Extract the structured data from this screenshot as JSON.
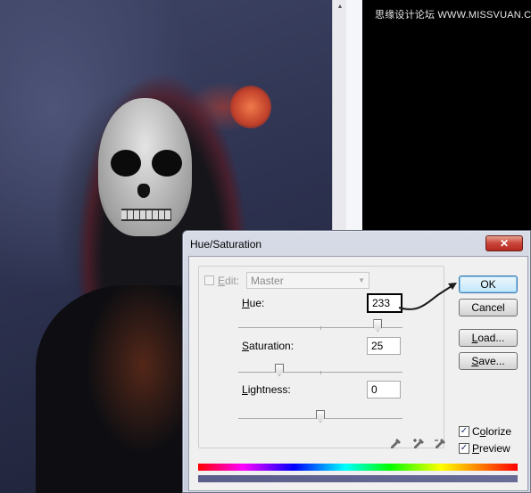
{
  "watermark": {
    "text": "思缘设计论坛 WWW.MISSVUAN.COM"
  },
  "dialog": {
    "title": "Hue/Saturation",
    "close_label": "✕",
    "edit": {
      "label_prefix": "",
      "label_mnemonic": "E",
      "label_rest": "dit:",
      "selected": "Master"
    },
    "hue": {
      "label_mnemonic": "H",
      "label_rest": "ue:",
      "value": "233",
      "slider_fraction": 0.85
    },
    "saturation": {
      "label_mnemonic": "S",
      "label_rest": "aturation:",
      "value": "25",
      "slider_fraction": 0.25
    },
    "lightness": {
      "label_mnemonic": "L",
      "label_rest": "ightness:",
      "value": "0",
      "slider_fraction": 0.5
    },
    "buttons": {
      "ok": "OK",
      "cancel": "Cancel",
      "load_mnemonic": "L",
      "load_rest": "oad...",
      "save_mnemonic": "S",
      "save_rest": "ave..."
    },
    "colorize": {
      "label_pre": "C",
      "label_mnemonic": "o",
      "label_rest": "lorize",
      "checked": true
    },
    "preview": {
      "label_mnemonic": "P",
      "label_rest": "review",
      "checked": true
    },
    "check_glyph": "✓",
    "icons": [
      "eyedropper-icon",
      "eyedropper-plus-icon",
      "eyedropper-minus-icon"
    ]
  },
  "colors": {
    "result_bar": "#5b5d8a",
    "default_button_border": "#3c7fb1",
    "close_button": "#c9453a"
  }
}
